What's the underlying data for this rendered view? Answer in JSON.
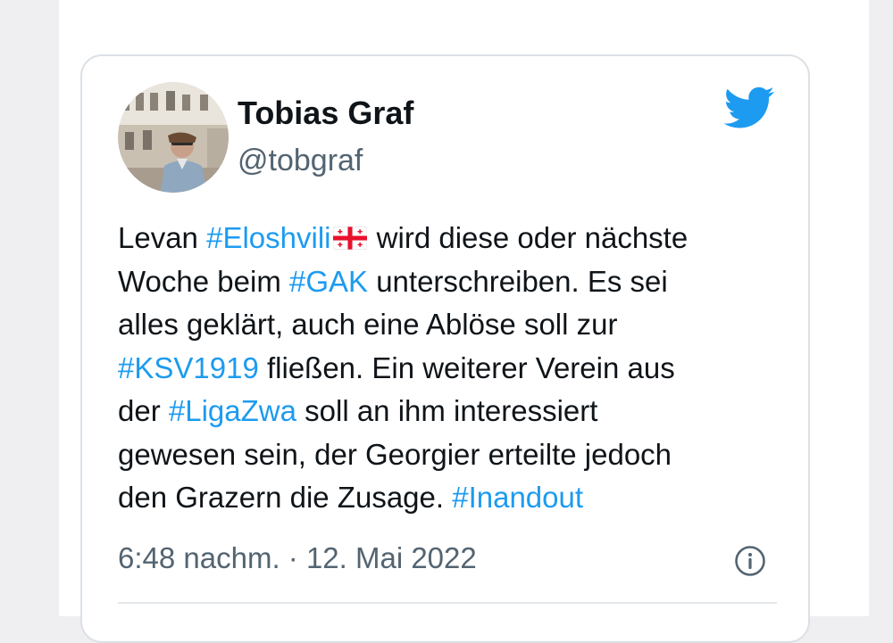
{
  "author": {
    "display_name": "Tobias Graf",
    "handle": "@tobgraf"
  },
  "icons": {
    "brand": "twitter-bird-icon",
    "info": "info-circle-icon",
    "flag": "georgia-flag-icon"
  },
  "colors": {
    "hashtag": "#1d9bf0",
    "twitter_blue": "#1d9bf0",
    "text": "#0f1419",
    "secondary_text": "#536471"
  },
  "tweet": {
    "line1": {
      "pre": "Levan ",
      "tag": "#Eloshvili",
      "post": " wird diese oder nächste"
    },
    "line2": {
      "pre": "Woche beim ",
      "tag": "#GAK",
      "post": " unterschreiben. Es sei"
    },
    "line3": {
      "text": "alles geklärt, auch eine Ablöse soll zur"
    },
    "line4": {
      "tag": "#KSV1919",
      "post": " fließen. Ein weiterer Verein aus"
    },
    "line5": {
      "pre": "der ",
      "tag": "#LigaZwa",
      "post": " soll an ihm interessiert"
    },
    "line6": {
      "text": "gewesen sein, der Georgier erteilte jedoch"
    },
    "line7": {
      "pre": "den Grazern die Zusage. ",
      "tag": "#Inandout"
    }
  },
  "timestamp": "6:48 nachm. · 12. Mai 2022"
}
